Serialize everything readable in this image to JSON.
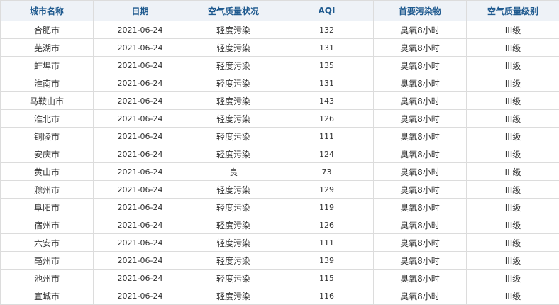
{
  "table": {
    "headers": [
      "城市名称",
      "日期",
      "空气质量状况",
      "AQI",
      "首要污染物",
      "空气质量级别"
    ],
    "rows": [
      [
        "合肥市",
        "2021-06-24",
        "轻度污染",
        "132",
        "臭氧8小时",
        "III级"
      ],
      [
        "芜湖市",
        "2021-06-24",
        "轻度污染",
        "131",
        "臭氧8小时",
        "III级"
      ],
      [
        "蚌埠市",
        "2021-06-24",
        "轻度污染",
        "135",
        "臭氧8小时",
        "III级"
      ],
      [
        "淮南市",
        "2021-06-24",
        "轻度污染",
        "131",
        "臭氧8小时",
        "III级"
      ],
      [
        "马鞍山市",
        "2021-06-24",
        "轻度污染",
        "143",
        "臭氧8小时",
        "III级"
      ],
      [
        "淮北市",
        "2021-06-24",
        "轻度污染",
        "126",
        "臭氧8小时",
        "III级"
      ],
      [
        "铜陵市",
        "2021-06-24",
        "轻度污染",
        "111",
        "臭氧8小时",
        "III级"
      ],
      [
        "安庆市",
        "2021-06-24",
        "轻度污染",
        "124",
        "臭氧8小时",
        "III级"
      ],
      [
        "黄山市",
        "2021-06-24",
        "良",
        "73",
        "臭氧8小时",
        "II 级"
      ],
      [
        "滁州市",
        "2021-06-24",
        "轻度污染",
        "129",
        "臭氧8小时",
        "III级"
      ],
      [
        "阜阳市",
        "2021-06-24",
        "轻度污染",
        "119",
        "臭氧8小时",
        "III级"
      ],
      [
        "宿州市",
        "2021-06-24",
        "轻度污染",
        "126",
        "臭氧8小时",
        "III级"
      ],
      [
        "六安市",
        "2021-06-24",
        "轻度污染",
        "111",
        "臭氧8小时",
        "III级"
      ],
      [
        "亳州市",
        "2021-06-24",
        "轻度污染",
        "139",
        "臭氧8小时",
        "III级"
      ],
      [
        "池州市",
        "2021-06-24",
        "轻度污染",
        "115",
        "臭氧8小时",
        "III级"
      ],
      [
        "宣城市",
        "2021-06-24",
        "轻度污染",
        "116",
        "臭氧8小时",
        "III级"
      ]
    ]
  }
}
